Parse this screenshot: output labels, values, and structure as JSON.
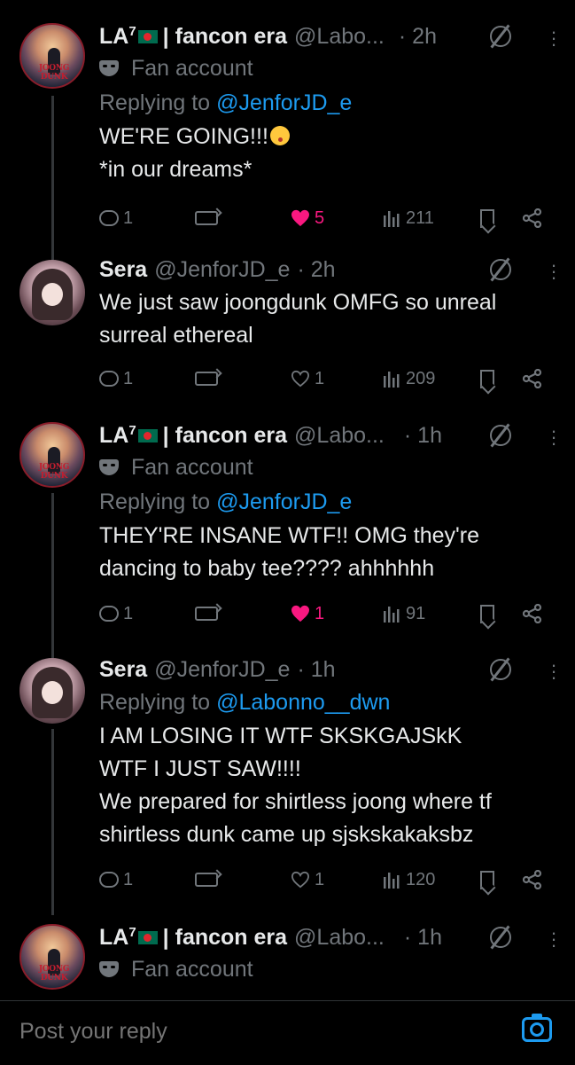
{
  "tweets": [
    {
      "name": "LA",
      "name_sup": "7",
      "name_suffix": "| fancon era",
      "handle": "@Labo...",
      "time": "· 2h",
      "badge": "Fan account",
      "replying_prefix": "Replying to",
      "replying_to": "@JenforJD_e",
      "text": "WE'RE GOING!!!",
      "text2": "*in our dreams*",
      "replies": "1",
      "likes": "5",
      "views": "211",
      "liked": true
    },
    {
      "name": "Sera",
      "handle": "@JenforJD_e",
      "time": "· 2h",
      "text": "We just saw joongdunk OMFG so unreal\nsurreal ethereal",
      "replies": "1",
      "likes": "1",
      "views": "209",
      "liked": false
    },
    {
      "name": "LA",
      "name_sup": "7",
      "name_suffix": "| fancon era",
      "handle": "@Labo...",
      "time": "· 1h",
      "badge": "Fan account",
      "replying_prefix": "Replying to",
      "replying_to": "@JenforJD_e",
      "text": "THEY'RE INSANE WTF!! OMG they're\ndancing to baby tee???? ahhhhhh",
      "replies": "1",
      "likes": "1",
      "views": "91",
      "liked": true
    },
    {
      "name": "Sera",
      "handle": "@JenforJD_e",
      "time": "· 1h",
      "replying_prefix": "Replying to",
      "replying_to": "@Labonno__dwn",
      "text": "I AM LOSING IT WTF SKSKGAJSkK\nWTF I JUST SAW!!!!\nWe prepared for shirtless joong where tf\nshirtless dunk came up sjskskakaksbz",
      "replies": "1",
      "likes": "1",
      "views": "120",
      "liked": false
    },
    {
      "name": "LA",
      "name_sup": "7",
      "name_suffix": "| fancon era",
      "handle": "@Labo...",
      "time": "· 1h",
      "badge": "Fan account"
    }
  ],
  "avatar_text": "JOONG DUNK",
  "reply_bar": {
    "placeholder": "Post your reply"
  },
  "colors": {
    "background": "#000000",
    "text": "#e7e9ea",
    "muted": "#71767b",
    "link": "#1d9bf0",
    "like": "#f91880"
  },
  "icons": [
    "reply-icon",
    "retweet-icon",
    "heart-icon",
    "views-icon",
    "bookmark-icon",
    "share-icon",
    "blocked-icon",
    "more-icon",
    "fan-mask-icon",
    "camera-icon",
    "bangladesh-flag-icon",
    "kiss-emoji-icon"
  ]
}
